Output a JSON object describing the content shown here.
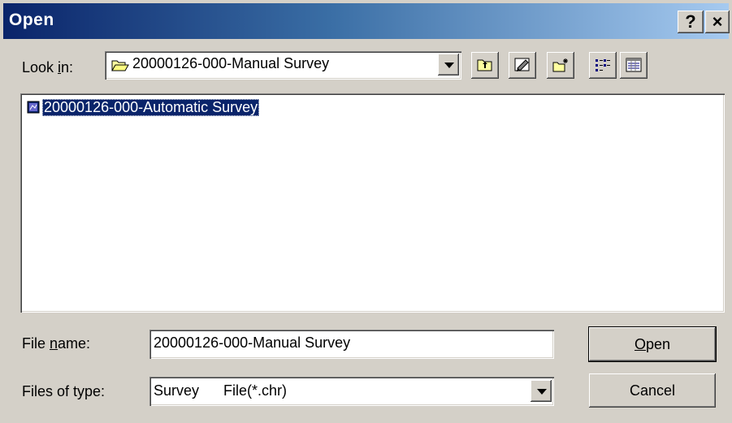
{
  "window": {
    "title": "Open",
    "help_glyph": "?",
    "close_glyph": "×"
  },
  "look_in": {
    "label_before": "Look ",
    "label_accel": "i",
    "label_after": "n:",
    "value": "20000126-000-Manual Survey",
    "icon": "folder-open-icon"
  },
  "toolbar": {
    "buttons": [
      "up-one-level-icon",
      "desktop-icon",
      "new-folder-icon",
      "list-view-icon",
      "details-view-icon"
    ]
  },
  "files": [
    {
      "name": "20000126-000-Automatic Survey",
      "icon": "survey-file-icon",
      "selected": true
    }
  ],
  "file_name": {
    "label_before": "File ",
    "label_accel": "n",
    "label_after": "ame:",
    "value": "20000126-000-Manual Survey"
  },
  "file_type": {
    "label": "Files of type:",
    "value": "Survey      File(*.chr)"
  },
  "buttons": {
    "open_accel": "O",
    "open_rest": "pen",
    "cancel": "Cancel"
  },
  "colors": {
    "title_start": "#0a246a",
    "title_end": "#a6caf0",
    "face": "#d4d0c8",
    "selection": "#0a246a"
  }
}
